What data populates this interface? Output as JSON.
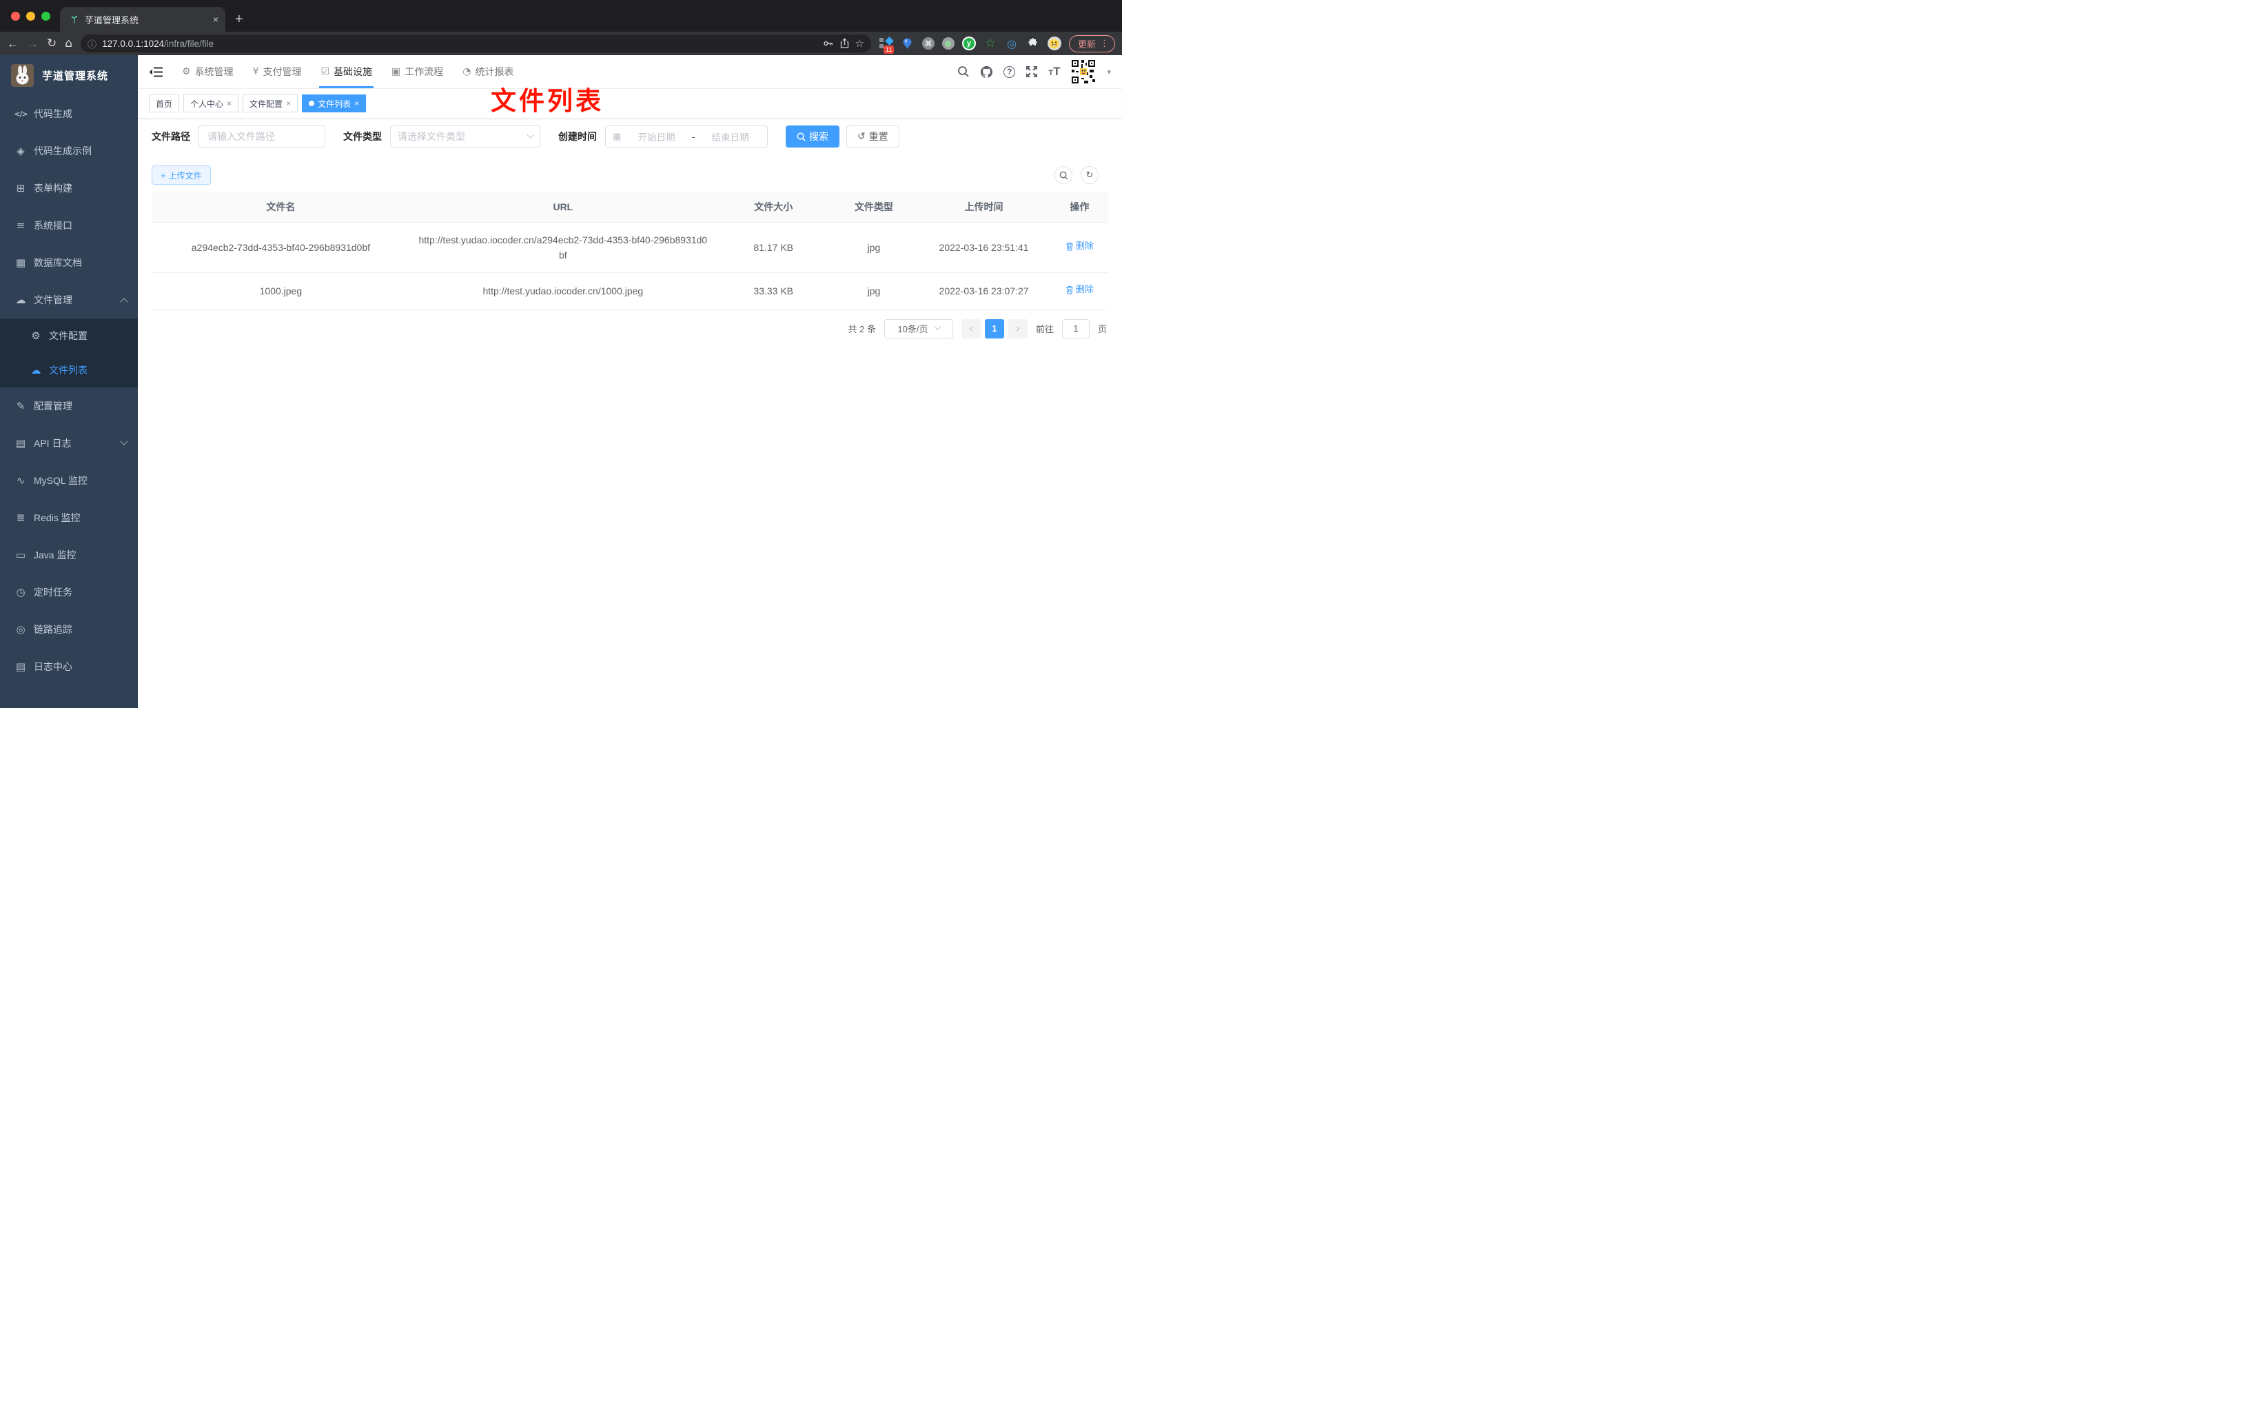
{
  "colors": {
    "accent": "#409eff",
    "sidebar_bg": "#304156",
    "submenu_bg": "#1f2d3d",
    "tag_active": "#409eff",
    "annotation_red": "#ff1200",
    "delete_link": "#409eff",
    "header_underline": "#409eff"
  },
  "browser": {
    "tab_title": "芋道管理系统",
    "tab_close": "×",
    "new_tab": "+",
    "url_host": "127.0.0.1:1024",
    "url_path": "/infra/file/file",
    "extensions": {
      "badge_count": "11",
      "cmd_glyph": "⌘",
      "y_glyph": "y",
      "star_glyph": "☆",
      "eye_glyph": "◎"
    },
    "update_label": "更新",
    "menu_dots": "⋮"
  },
  "sidebar": {
    "title": "芋道管理系统",
    "items": [
      {
        "icon": "code-icon",
        "glyph": "</>",
        "label": "代码生成"
      },
      {
        "icon": "shield-check-icon",
        "glyph": "◈",
        "label": "代码生成示例"
      },
      {
        "icon": "form-builder-icon",
        "glyph": "⊞",
        "label": "表单构建"
      },
      {
        "icon": "sliders-icon",
        "glyph": "≡",
        "label": "系统接口"
      },
      {
        "icon": "database-doc-icon",
        "glyph": "▦",
        "label": "数据库文档"
      },
      {
        "icon": "cloud-icon",
        "glyph": "☁",
        "label": "文件管理"
      },
      {
        "icon": "edit-icon",
        "glyph": "✎",
        "label": "配置管理"
      },
      {
        "icon": "api-log-icon",
        "glyph": "▤",
        "label": "API 日志"
      },
      {
        "icon": "mysql-monitor-icon",
        "glyph": "∿",
        "label": "MySQL 监控"
      },
      {
        "icon": "redis-monitor-icon",
        "glyph": "≣",
        "label": "Redis 监控"
      },
      {
        "icon": "java-monitor-icon",
        "glyph": "▭",
        "label": "Java 监控"
      },
      {
        "icon": "scheduled-task-icon",
        "glyph": "◷",
        "label": "定时任务"
      },
      {
        "icon": "trace-icon",
        "glyph": "◎",
        "label": "链路追踪"
      },
      {
        "icon": "log-center-icon",
        "glyph": "▤",
        "label": "日志中心"
      }
    ],
    "submenu": [
      {
        "icon": "gear-icon",
        "glyph": "⚙",
        "label": "文件配置"
      },
      {
        "icon": "cloud-upload-icon",
        "glyph": "☁",
        "label": "文件列表"
      }
    ]
  },
  "header": {
    "nav": [
      {
        "glyph": "⚙",
        "label": "系统管理"
      },
      {
        "glyph": "¥",
        "label": "支付管理"
      },
      {
        "glyph": "☑",
        "label": "基础设施"
      },
      {
        "glyph": "▣",
        "label": "工作流程"
      },
      {
        "glyph": "◔",
        "label": "统计报表"
      }
    ]
  },
  "tags": [
    {
      "label": "首页"
    },
    {
      "label": "个人中心",
      "close": "×"
    },
    {
      "label": "文件配置",
      "close": "×"
    },
    {
      "label": "文件列表",
      "close": "×"
    }
  ],
  "annotation": {
    "text": "文件列表"
  },
  "filters": {
    "path_label": "文件路径",
    "path_placeholder": "请输入文件路径",
    "type_label": "文件类型",
    "type_placeholder": "请选择文件类型",
    "date_label": "创建时间",
    "date_start_placeholder": "开始日期",
    "date_separator": "-",
    "date_end_placeholder": "结束日期",
    "calendar_glyph": "▦",
    "search_label": "搜索",
    "reset_label": "重置",
    "reset_glyph": "↺"
  },
  "toolbar": {
    "upload_label": "上传文件",
    "plus": "+",
    "refresh_glyph": "↻"
  },
  "table": {
    "columns": [
      "文件名",
      "URL",
      "文件大小",
      "文件类型",
      "上传时间",
      "操作"
    ],
    "rows": [
      {
        "name": "a294ecb2-73dd-4353-bf40-296b8931d0bf",
        "url": "http://test.yudao.iocoder.cn/a294ecb2-73dd-4353-bf40-296b8931d0bf",
        "size": "81.17 KB",
        "type": "jpg",
        "time": "2022-03-16 23:51:41",
        "action": "删除"
      },
      {
        "name": "1000.jpeg",
        "url": "http://test.yudao.iocoder.cn/1000.jpeg",
        "size": "33.33 KB",
        "type": "jpg",
        "time": "2022-03-16 23:07:27",
        "action": "删除"
      }
    ]
  },
  "pagination": {
    "total": "共 2 条",
    "per_page": "10条/页",
    "prev": "‹",
    "page": "1",
    "next": "›",
    "goto_label": "前往",
    "goto_value": "1",
    "page_suffix": "页"
  }
}
